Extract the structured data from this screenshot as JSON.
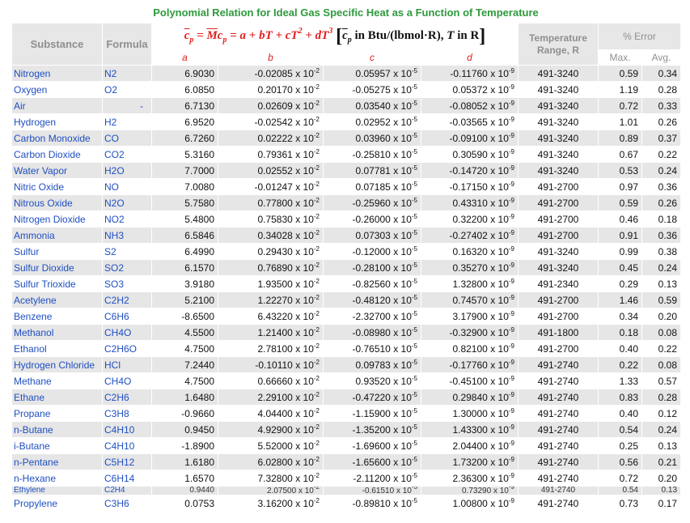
{
  "title": "Polynomial Relation for Ideal Gas Specific Heat as a Function of Temperature",
  "header": {
    "substance": "Substance",
    "formula": "Formula",
    "equation": {
      "lhs_cp": "c",
      "lhs_p": "p",
      "eq": "=",
      "M": "M",
      "cp2": "c",
      "p2": "p",
      "rhs": "= a + bT + cT",
      "sq": "2",
      "plus_d": " + dT",
      "cube": "3",
      "units_cp": "c",
      "units_p": "p",
      "units_text": " in Btu/",
      "units_lbmol": "(lbmol·R)",
      "units_tail": ", ",
      "units_T": "T",
      "units_inR": " in R"
    },
    "temperature_range": "Temperature Range, R",
    "pct_error": "% Error",
    "cols": {
      "a": "a",
      "b": "b",
      "c": "c",
      "d": "d"
    },
    "max": "Max.",
    "avg": "Avg."
  },
  "rows": [
    {
      "name": "Nitrogen",
      "formula": "N2",
      "a": "6.9030",
      "b": "-0.02085",
      "be": "-2",
      "c": "0.05957",
      "ce": "-5",
      "d": "-0.11760",
      "de": "-9",
      "range": "491-3240",
      "max": "0.59",
      "avg": "0.34"
    },
    {
      "name": "Oxygen",
      "formula": "O2",
      "a": "6.0850",
      "b": "0.20170",
      "be": "-2",
      "c": "-0.05275",
      "ce": "-5",
      "d": "0.05372",
      "de": "-9",
      "range": "491-3240",
      "max": "1.19",
      "avg": "0.28"
    },
    {
      "name": "Air",
      "formula": "-",
      "a": "6.7130",
      "b": "0.02609",
      "be": "-2",
      "c": "0.03540",
      "ce": "-5",
      "d": "-0.08052",
      "de": "-9",
      "range": "491-3240",
      "max": "0.72",
      "avg": "0.33"
    },
    {
      "name": "Hydrogen",
      "formula": "H2",
      "a": "6.9520",
      "b": "-0.02542",
      "be": "-2",
      "c": "0.02952",
      "ce": "-5",
      "d": "-0.03565",
      "de": "-9",
      "range": "491-3240",
      "max": "1.01",
      "avg": "0.26"
    },
    {
      "name": "Carbon Monoxide",
      "formula": "CO",
      "a": "6.7260",
      "b": "0.02222",
      "be": "-2",
      "c": "0.03960",
      "ce": "-5",
      "d": "-0.09100",
      "de": "-9",
      "range": "491-3240",
      "max": "0.89",
      "avg": "0.37"
    },
    {
      "name": "Carbon Dioxide",
      "formula": "CO2",
      "a": "5.3160",
      "b": "0.79361",
      "be": "-2",
      "c": "-0.25810",
      "ce": "-5",
      "d": "0.30590",
      "de": "-9",
      "range": "491-3240",
      "max": "0.67",
      "avg": "0.22"
    },
    {
      "name": "Water Vapor",
      "formula": "H2O",
      "a": "7.7000",
      "b": "0.02552",
      "be": "-2",
      "c": "0.07781",
      "ce": "-5",
      "d": "-0.14720",
      "de": "-9",
      "range": "491-3240",
      "max": "0.53",
      "avg": "0.24"
    },
    {
      "name": "Nitric Oxide",
      "formula": "NO",
      "a": "7.0080",
      "b": "-0.01247",
      "be": "-2",
      "c": "0.07185",
      "ce": "-5",
      "d": "-0.17150",
      "de": "-9",
      "range": "491-2700",
      "max": "0.97",
      "avg": "0.36"
    },
    {
      "name": "Nitrous Oxide",
      "formula": "N2O",
      "a": "5.7580",
      "b": "0.77800",
      "be": "-2",
      "c": "-0.25960",
      "ce": "-5",
      "d": "0.43310",
      "de": "-9",
      "range": "491-2700",
      "max": "0.59",
      "avg": "0.26"
    },
    {
      "name": "Nitrogen Dioxide",
      "formula": "NO2",
      "a": "5.4800",
      "b": "0.75830",
      "be": "-2",
      "c": "-0.26000",
      "ce": "-5",
      "d": "0.32200",
      "de": "-9",
      "range": "491-2700",
      "max": "0.46",
      "avg": "0.18"
    },
    {
      "name": "Ammonia",
      "formula": "NH3",
      "a": "6.5846",
      "b": "0.34028",
      "be": "-2",
      "c": "0.07303",
      "ce": "-5",
      "d": "-0.27402",
      "de": "-9",
      "range": "491-2700",
      "max": "0.91",
      "avg": "0.36"
    },
    {
      "name": "Sulfur",
      "formula": "S2",
      "a": "6.4990",
      "b": "0.29430",
      "be": "-2",
      "c": "-0.12000",
      "ce": "-5",
      "d": "0.16320",
      "de": "-9",
      "range": "491-3240",
      "max": "0.99",
      "avg": "0.38"
    },
    {
      "name": "Sulfur Dioxide",
      "formula": "SO2",
      "a": "6.1570",
      "b": "0.76890",
      "be": "-2",
      "c": "-0.28100",
      "ce": "-5",
      "d": "0.35270",
      "de": "-9",
      "range": "491-3240",
      "max": "0.45",
      "avg": "0.24"
    },
    {
      "name": "Sulfur Trioxide",
      "formula": "SO3",
      "a": "3.9180",
      "b": "1.93500",
      "be": "-2",
      "c": "-0.82560",
      "ce": "-5",
      "d": "1.32800",
      "de": "-9",
      "range": "491-2340",
      "max": "0.29",
      "avg": "0.13"
    },
    {
      "name": "Acetylene",
      "formula": "C2H2",
      "a": "5.2100",
      "b": "1.22270",
      "be": "-2",
      "c": "-0.48120",
      "ce": "-5",
      "d": "0.74570",
      "de": "-9",
      "range": "491-2700",
      "max": "1.46",
      "avg": "0.59"
    },
    {
      "name": "Benzene",
      "formula": "C6H6",
      "a": "-8.6500",
      "b": "6.43220",
      "be": "-2",
      "c": "-2.32700",
      "ce": "-5",
      "d": "3.17900",
      "de": "-9",
      "range": "491-2700",
      "max": "0.34",
      "avg": "0.20"
    },
    {
      "name": "Methanol",
      "formula": "CH4O",
      "a": "4.5500",
      "b": "1.21400",
      "be": "-2",
      "c": "-0.08980",
      "ce": "-5",
      "d": "-0.32900",
      "de": "-9",
      "range": "491-1800",
      "max": "0.18",
      "avg": "0.08"
    },
    {
      "name": "Ethanol",
      "formula": "C2H6O",
      "a": "4.7500",
      "b": "2.78100",
      "be": "-2",
      "c": "-0.76510",
      "ce": "-5",
      "d": "0.82100",
      "de": "-9",
      "range": "491-2700",
      "max": "0.40",
      "avg": "0.22"
    },
    {
      "name": "Hydrogen Chloride",
      "formula": "HCl",
      "a": "7.2440",
      "b": "-0.10110",
      "be": "-2",
      "c": "0.09783",
      "ce": "-5",
      "d": "-0.17760",
      "de": "-9",
      "range": "491-2740",
      "max": "0.22",
      "avg": "0.08"
    },
    {
      "name": "Methane",
      "formula": "CH4O",
      "a": "4.7500",
      "b": "0.66660",
      "be": "-2",
      "c": "0.93520",
      "ce": "-5",
      "d": "-0.45100",
      "de": "-9",
      "range": "491-2740",
      "max": "1.33",
      "avg": "0.57"
    },
    {
      "name": "Ethane",
      "formula": "C2H6",
      "a": "1.6480",
      "b": "2.29100",
      "be": "-2",
      "c": "-0.47220",
      "ce": "-5",
      "d": "0.29840",
      "de": "-9",
      "range": "491-2740",
      "max": "0.83",
      "avg": "0.28"
    },
    {
      "name": "Propane",
      "formula": "C3H8",
      "a": "-0.9660",
      "b": "4.04400",
      "be": "-2",
      "c": "-1.15900",
      "ce": "-5",
      "d": "1.30000",
      "de": "-9",
      "range": "491-2740",
      "max": "0.40",
      "avg": "0.12"
    },
    {
      "name": "n-Butane",
      "formula": "C4H10",
      "a": "0.9450",
      "b": "4.92900",
      "be": "-2",
      "c": "-1.35200",
      "ce": "-5",
      "d": "1.43300",
      "de": "-9",
      "range": "491-2740",
      "max": "0.54",
      "avg": "0.24"
    },
    {
      "name": "i-Butane",
      "formula": "C4H10",
      "a": "-1.8900",
      "b": "5.52000",
      "be": "-2",
      "c": "-1.69600",
      "ce": "-5",
      "d": "2.04400",
      "de": "-9",
      "range": "491-2740",
      "max": "0.25",
      "avg": "0.13"
    },
    {
      "name": "n-Pentane",
      "formula": "C5H12",
      "a": "1.6180",
      "b": "6.02800",
      "be": "-2",
      "c": "-1.65600",
      "ce": "-5",
      "d": "1.73200",
      "de": "-9",
      "range": "491-2740",
      "max": "0.56",
      "avg": "0.21"
    },
    {
      "name": "n-Hexane",
      "formula": "C6H14",
      "a": "1.6570",
      "b": "7.32800",
      "be": "-2",
      "c": "-2.11200",
      "ce": "-5",
      "d": "2.36300",
      "de": "-9",
      "range": "491-2740",
      "max": "0.72",
      "avg": "0.20"
    }
  ],
  "clipped_row": {
    "name": "Ethylene",
    "formula": "C2H4",
    "a": "0.9440",
    "b": "2.07500",
    "be": "-2",
    "c": "-0.61510",
    "ce": "-5",
    "d": "0.73290",
    "de": "-9",
    "range": "491-2740",
    "max": "0.54",
    "avg": "0.13"
  },
  "last_row": {
    "name": "Propylene",
    "formula": "C3H6",
    "a": "0.0753",
    "b": "3.16200",
    "be": "-2",
    "c": "-0.89810",
    "ce": "-5",
    "d": "1.00800",
    "de": "-9",
    "range": "491-2740",
    "max": "0.73",
    "avg": "0.17"
  },
  "times": "x 10"
}
